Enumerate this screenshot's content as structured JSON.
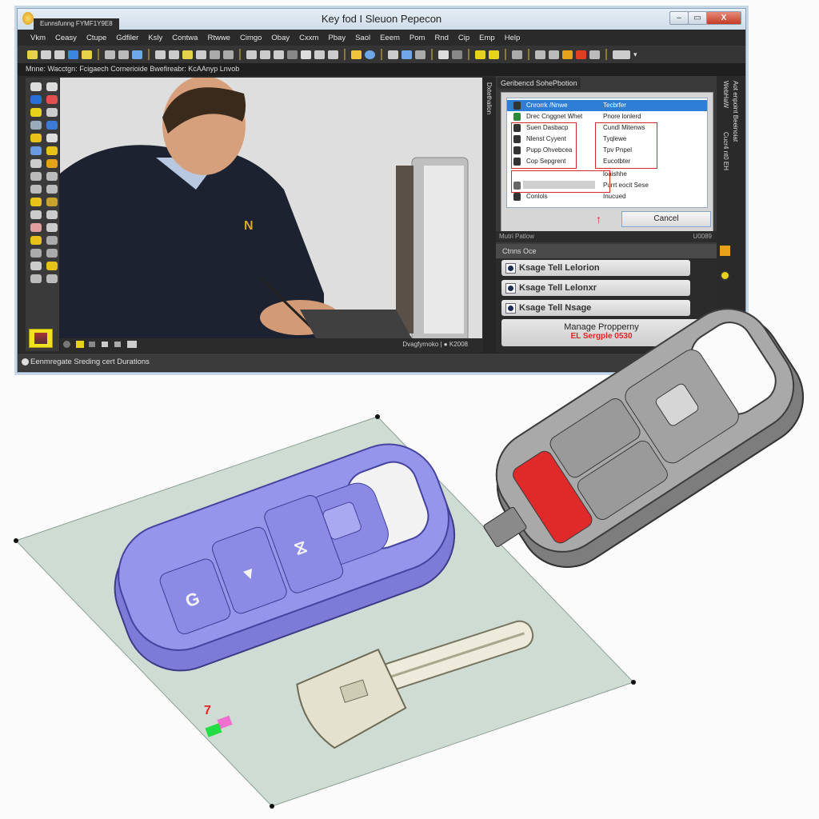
{
  "window": {
    "title": "Key fod I Sleuon Pepecon",
    "document_tab": "Eunnsfunng FYMF1Y9E8",
    "controls": {
      "minimize": "–",
      "maximize": "▭",
      "close": "X"
    }
  },
  "menubar": [
    "Vkm",
    "Ceasy",
    "Ctupe",
    "Gdfiler",
    "Ksly",
    "Contwa",
    "Rtwwe",
    "Cimgo",
    "Obay",
    "Cxxm",
    "Pbay",
    "Saol",
    "Eeem",
    "Pom",
    "Rnd",
    "Cip",
    "Emp",
    "Help"
  ],
  "pathbar": {
    "text": "Mnne: Wacctgn: Fcigaech Cornerioide Bwefireabr: KcAAnyp Lnvob"
  },
  "viewport": {
    "scene": "Technician writing at desk next to computer",
    "shirt_logo": "N",
    "status_text": "Dvagfyrnoko",
    "zoom_text": "K2008"
  },
  "right_panel": {
    "header": "Geribencd SohePbotion",
    "list": [
      {
        "name": "Cnrorrk /Nnwe",
        "value": "Tecbrfer",
        "selected": true
      },
      {
        "name": "Drec Cnggnet Whet",
        "value": "Pnore lonlerd",
        "selected": false
      },
      {
        "name": "Suen Dasbacp",
        "value": "Cundl Mitenws",
        "selected": false
      },
      {
        "name": "Nlenst Cyyent",
        "value": "Tyqlewe",
        "selected": false
      },
      {
        "name": "Pupp Ohvebcea",
        "value": "Tpv Pnpel",
        "selected": false
      },
      {
        "name": "Cop Sepgrent",
        "value": "Eucotbter",
        "selected": false
      },
      {
        "name": "",
        "value": "loaishhe",
        "selected": false
      },
      {
        "name": "",
        "value": "Purrt eocit Sese",
        "selected": false
      },
      {
        "name": "Conlols",
        "value": "Inucued",
        "selected": false
      }
    ],
    "cancel_label": "Cancel",
    "arrow": "↑"
  },
  "lower_panel": {
    "section_title": "Mutri Patlow",
    "section_value": "U0089",
    "group_title": "Ctnns Oce",
    "options": [
      {
        "label": "Ksage Tell Lelorion",
        "checked": true
      },
      {
        "label": "Ksage Tell Lelonxr",
        "checked": true
      },
      {
        "label": "Ksage Tell Nsage",
        "checked": true
      }
    ],
    "manage_label": "Manage Propperny",
    "manage_sub": "EL Sergple 0530"
  },
  "side_tabs": [
    "Dxtethalion",
    "WebHaW",
    "Cucr4 nt0 EH",
    "Aot enpoint Beeinoiat"
  ],
  "statusbar": {
    "text": "Eenmregate Sreding cert Durations"
  },
  "scene": {
    "purple_fob": {
      "color": "#8d8de6",
      "buttons": [
        "G",
        "▼",
        "⧖"
      ]
    },
    "grey_fob": {
      "color": "#8f8f8f",
      "panic_color": "#e02a2a"
    },
    "key_blade": {
      "color": "#e8e6d6"
    },
    "marker": "7",
    "plane_color": "#cfdcd3"
  }
}
